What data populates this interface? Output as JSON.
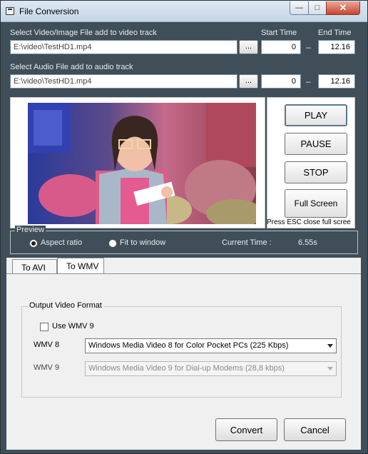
{
  "window": {
    "title": "File Conversion",
    "controls": {
      "minimize": "—",
      "maximize": "□",
      "close": "✕"
    }
  },
  "video_track": {
    "label": "Select Video/Image File add to video track",
    "path": "E:\\video\\TestHD1.mp4",
    "browse_label": "...",
    "start_label": "Start Time",
    "end_label": "End Time",
    "start": "0",
    "end": "12.16",
    "separator": "–"
  },
  "audio_track": {
    "label": "Select Audio File add to audio track",
    "path": "E:\\video\\TestHD1.mp4",
    "browse_label": "...",
    "start": "0",
    "end": "12.16",
    "separator": "–"
  },
  "player": {
    "play": "PLAY",
    "pause": "PAUSE",
    "stop": "STOP",
    "fullscreen": "Full Screen",
    "esc_note": "Press ESC close full scree"
  },
  "preview": {
    "legend": "Preview",
    "aspect_ratio": "Aspect ratio",
    "fit_to_window": "Fit to window",
    "selected": "aspect_ratio",
    "current_time_label": "Current Time :",
    "current_time": "6.55s"
  },
  "tabs": [
    {
      "label": "To AVI",
      "active": false
    },
    {
      "label": "To WMV",
      "active": true
    }
  ],
  "output_format": {
    "legend": "Output Video Format",
    "use_wmv9_label": "Use WMV 9",
    "use_wmv9_checked": false,
    "wmv8_label": "WMV 8",
    "wmv8_value": "Windows Media Video 8 for Color Pocket PCs (225 Kbps)",
    "wmv9_label": "WMV 9",
    "wmv9_value": "Windows Media Video 9 for Dial-up Modems (28,8 kbps)"
  },
  "actions": {
    "convert": "Convert",
    "cancel": "Cancel"
  },
  "colors": {
    "panel_bg": "#3f4e58",
    "label_text": "#e8ecef",
    "accent": "#3c7fb1"
  }
}
